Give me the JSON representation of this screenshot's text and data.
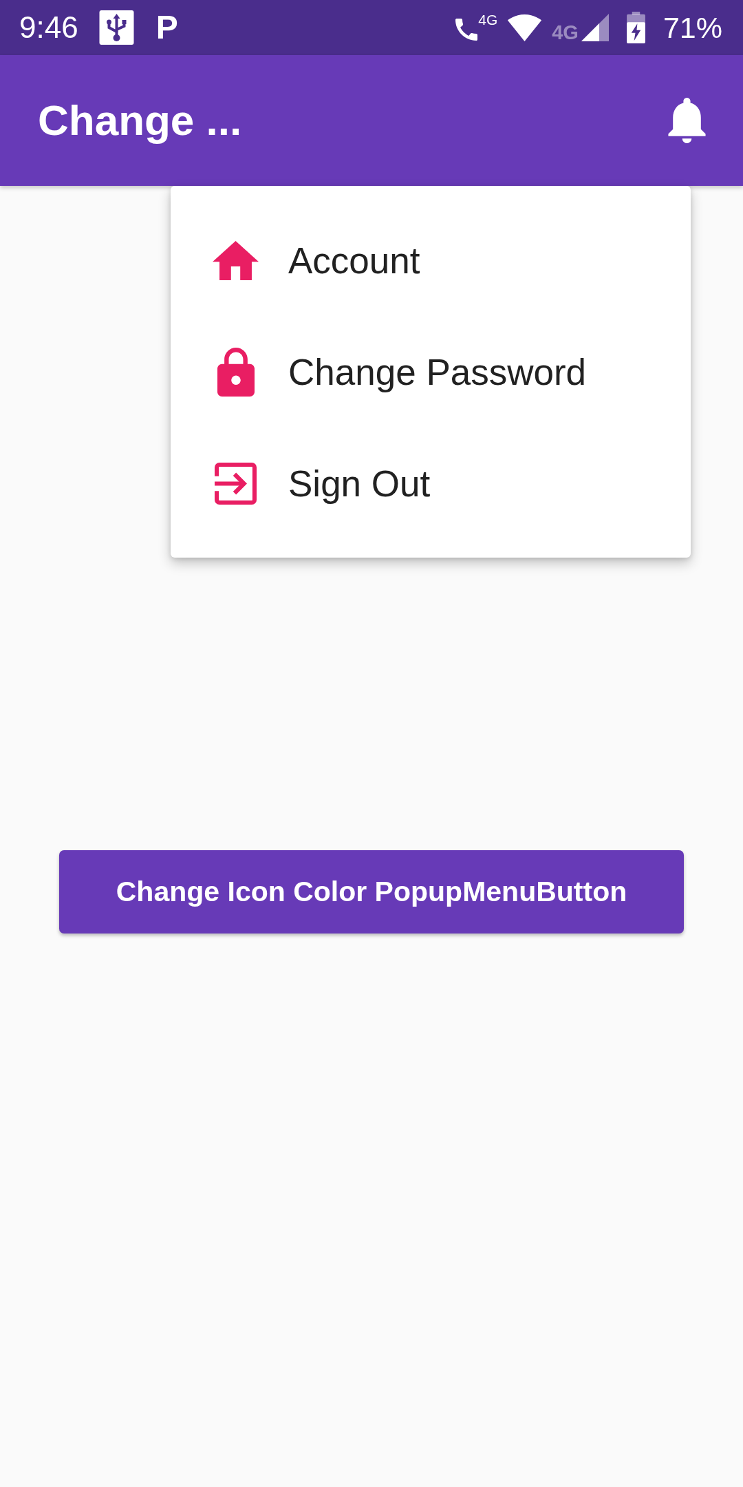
{
  "status_bar": {
    "time": "9:46",
    "notification_letter": "P",
    "call_network": "4G",
    "data_network": "4G",
    "battery": "71%"
  },
  "app_bar": {
    "title": "Change ..."
  },
  "popup_menu": {
    "items": [
      {
        "label": "Account"
      },
      {
        "label": "Change Password"
      },
      {
        "label": "Sign Out"
      }
    ]
  },
  "button": {
    "label": "Change Icon Color PopupMenuButton"
  }
}
